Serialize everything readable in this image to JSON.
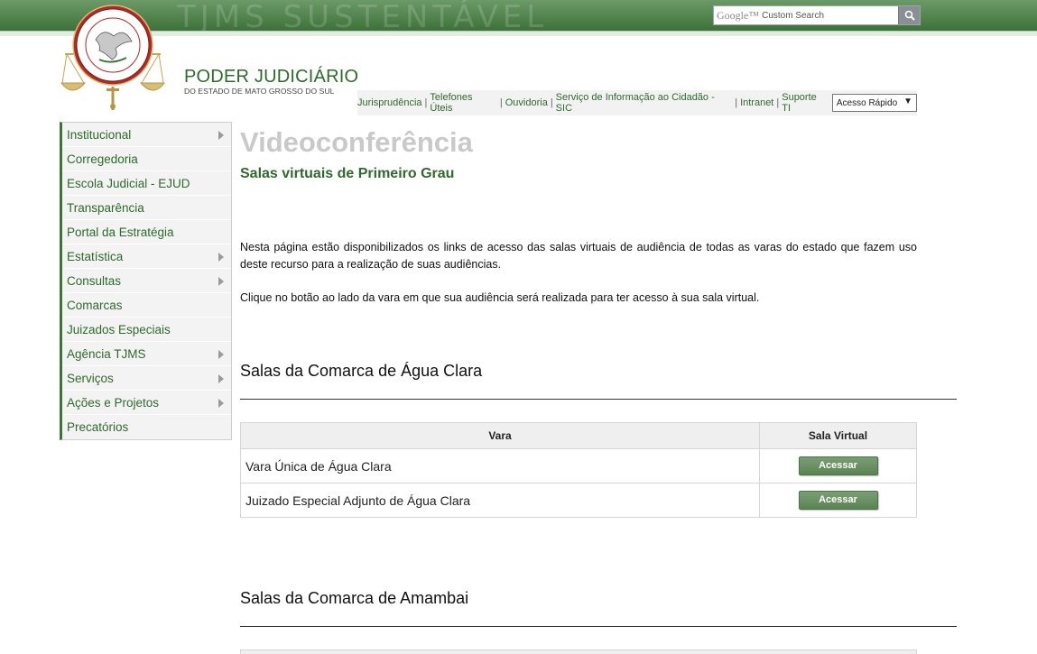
{
  "banner": {
    "title": "TJMS SUSTENTÁVEL"
  },
  "search": {
    "brand": "Google™",
    "placeholder": "Custom Search"
  },
  "header": {
    "org_name": "PODER JUDICIÁRIO",
    "org_sub": "DO ESTADO DE MATO GROSSO DO SUL"
  },
  "util_links": [
    "Jurisprudência",
    "Telefones Úteis",
    "Ouvidoria",
    "Serviço de Informação ao Cidadão - SIC",
    "Intranet",
    "Suporte TI"
  ],
  "quick_access": {
    "selected": "Acesso Rápido"
  },
  "sidebar": {
    "items": [
      {
        "label": "Institucional",
        "has_submenu": true
      },
      {
        "label": "Corregedoria",
        "has_submenu": false
      },
      {
        "label": "Escola Judicial - EJUD",
        "has_submenu": false
      },
      {
        "label": "Transparência",
        "has_submenu": false
      },
      {
        "label": "Portal da Estratégia",
        "has_submenu": false
      },
      {
        "label": "Estatística",
        "has_submenu": true
      },
      {
        "label": "Consultas",
        "has_submenu": true
      },
      {
        "label": "Comarcas",
        "has_submenu": false
      },
      {
        "label": "Juizados Especiais",
        "has_submenu": false
      },
      {
        "label": "Agência TJMS",
        "has_submenu": true
      },
      {
        "label": "Serviços",
        "has_submenu": true
      },
      {
        "label": "Ações e Projetos",
        "has_submenu": true
      },
      {
        "label": "Precatórios",
        "has_submenu": false
      }
    ]
  },
  "main": {
    "title": "Videoconferência",
    "subtitle": "Salas virtuais de Primeiro Grau",
    "intro": "Nesta página estão disponibilizados os links de acesso das salas virtuais de audiência de todas as varas do estado que fazem uso deste recurso para a realização de suas audiências.",
    "instruction": "Clique no botão ao lado da vara em que sua audiência será realizada para ter acesso à sua sala virtual.",
    "table_headers": {
      "vara": "Vara",
      "sala": "Sala Virtual"
    },
    "sections": [
      {
        "title": "Salas da Comarca de Água Clara",
        "rows": [
          {
            "vara": "Vara Única de Água Clara",
            "button": "Acessar"
          },
          {
            "vara": "Juizado Especial Adjunto de Água Clara",
            "button": "Acessar"
          }
        ]
      },
      {
        "title": "Salas da Comarca de Amambai",
        "rows": []
      }
    ]
  },
  "colors": {
    "brand_green": "#2f6a2c",
    "banner_green": "#3e7139",
    "button_green": "#5a8453",
    "title_gray": "#c9c9c9"
  }
}
